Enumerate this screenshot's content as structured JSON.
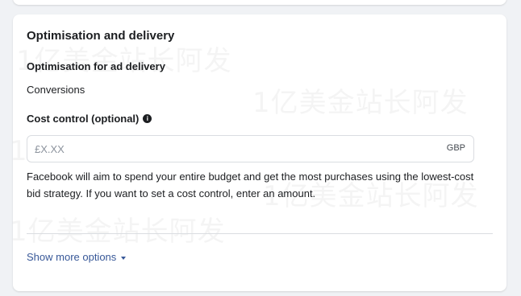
{
  "watermark_text": "1亿美金站长阿发",
  "section": {
    "title": "Optimisation and delivery",
    "optimisation_label": "Optimisation for ad delivery",
    "optimisation_value": "Conversions",
    "cost_control_label": "Cost control (optional)",
    "info_icon": "info-icon",
    "cost_input": {
      "placeholder": "£X.XX",
      "value": "",
      "currency": "GBP"
    },
    "help_text": "Facebook will aim to spend your entire budget and get the most purchases using the lowest-cost bid strategy. If you want to set a cost control, enter an amount.",
    "show_more_label": "Show more options"
  },
  "colors": {
    "link": "#385898",
    "text": "#1c1e21",
    "border": "#dadde1",
    "page_bg": "#f0f2f5"
  }
}
